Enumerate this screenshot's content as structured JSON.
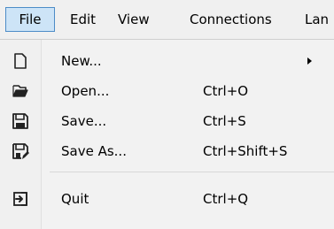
{
  "menubar": {
    "items": [
      {
        "label": "File"
      },
      {
        "label": "Edit"
      },
      {
        "label": "View"
      },
      {
        "label": "Connections"
      },
      {
        "label": "Lan"
      }
    ]
  },
  "file_menu": {
    "items": [
      {
        "label": "New...",
        "shortcut": "",
        "icon": "new-file-icon",
        "has_submenu": true
      },
      {
        "label": "Open...",
        "shortcut": "Ctrl+O",
        "icon": "folder-open-icon"
      },
      {
        "label": "Save...",
        "shortcut": "Ctrl+S",
        "icon": "floppy-disk-icon"
      },
      {
        "label": "Save As...",
        "shortcut": "Ctrl+Shift+S",
        "icon": "floppy-disk-save-as-icon"
      },
      {
        "label": "Quit",
        "shortcut": "Ctrl+Q",
        "icon": "exit-icon"
      }
    ]
  }
}
